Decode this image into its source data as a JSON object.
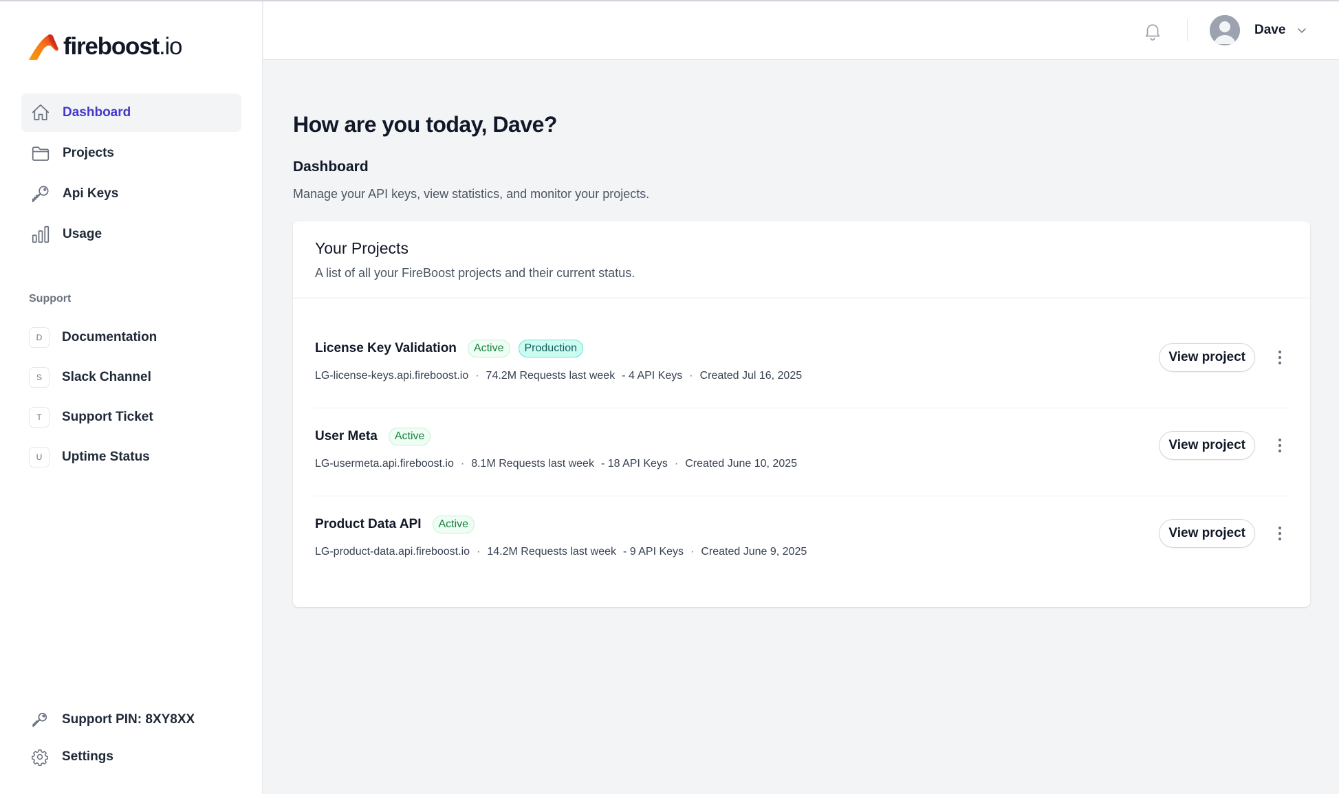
{
  "brand": {
    "name": "fireboost",
    "tld": ".io"
  },
  "sidebar": {
    "nav": [
      {
        "label": "Dashboard",
        "icon": "home-icon",
        "active": true
      },
      {
        "label": "Projects",
        "icon": "folder-icon"
      },
      {
        "label": "Api Keys",
        "icon": "key-icon"
      },
      {
        "label": "Usage",
        "icon": "chart-bar-icon"
      }
    ],
    "support_title": "Support",
    "support": [
      {
        "letter": "D",
        "label": "Documentation"
      },
      {
        "letter": "S",
        "label": "Slack Channel"
      },
      {
        "letter": "T",
        "label": "Support Ticket"
      },
      {
        "letter": "U",
        "label": "Uptime Status"
      }
    ],
    "bottom": [
      {
        "label": "Support PIN: 8XY8XX",
        "icon": "key-icon"
      },
      {
        "label": "Settings",
        "icon": "gear-icon"
      }
    ]
  },
  "header": {
    "user_name": "Dave"
  },
  "main": {
    "greeting": "How are you today, Dave?",
    "section_title": "Dashboard",
    "section_desc": "Manage your API keys, view statistics, and monitor your projects.",
    "card_title": "Your Projects",
    "card_desc": "A list of all your FireBoost projects and their current status.",
    "view_label": "View project",
    "projects": [
      {
        "name": "License Key Validation",
        "badges": [
          "Active",
          "Production"
        ],
        "host": "LG-license-keys.api.fireboost.io",
        "requests": "74.2M Requests last week",
        "keys": "- 4 API Keys",
        "created": "Created Jul 16, 2025"
      },
      {
        "name": "User Meta",
        "badges": [
          "Active"
        ],
        "host": "LG-usermeta.api.fireboost.io",
        "requests": "8.1M Requests last week",
        "keys": "- 18 API Keys",
        "created": "Created June 10, 2025"
      },
      {
        "name": "Product Data API",
        "badges": [
          "Active"
        ],
        "host": "LG-product-data.api.fireboost.io",
        "requests": "14.2M Requests last week",
        "keys": "- 9 API Keys",
        "created": "Created June 9, 2025"
      }
    ]
  },
  "colors": {
    "accent": "#4338ca",
    "active_badge": "#15803d",
    "production_badge": "#115e59"
  }
}
